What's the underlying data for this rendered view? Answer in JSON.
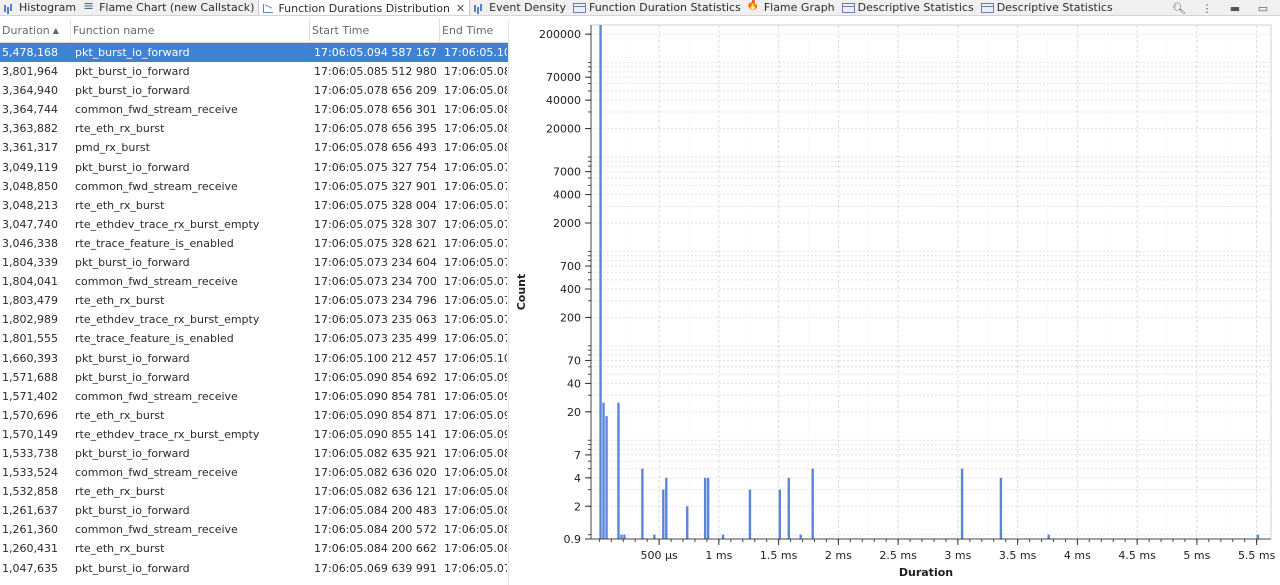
{
  "tabs": [
    {
      "label": "Histogram",
      "icon": "histogram-icon",
      "active": false
    },
    {
      "label": "Flame Chart (new Callstack)",
      "icon": "list-icon",
      "active": false
    },
    {
      "label": "Function Durations Distribution",
      "icon": "line-chart-icon",
      "active": true
    },
    {
      "label": "Event Density",
      "icon": "histogram-icon",
      "active": false
    },
    {
      "label": "Function Duration Statistics",
      "icon": "table-icon",
      "active": false
    },
    {
      "label": "Flame Graph",
      "icon": "flame-icon",
      "active": false
    },
    {
      "label": "Descriptive Statistics",
      "icon": "table-icon",
      "active": false
    },
    {
      "label": "Descriptive Statistics",
      "icon": "table-icon",
      "active": false
    }
  ],
  "toolbar": {
    "icons": [
      "zoom-icon",
      "more-icon",
      "minimize-icon",
      "maximize-icon"
    ]
  },
  "table": {
    "columns": [
      "Duration",
      "Function name",
      "Start Time",
      "End Time"
    ],
    "sort_column": "Duration",
    "rows": [
      {
        "duration": "5,478,168",
        "function": "pkt_burst_io_forward",
        "start": "17:06:05.094 587 167",
        "end": "17:06:05.10",
        "selected": true
      },
      {
        "duration": "3,801,964",
        "function": "pkt_burst_io_forward",
        "start": "17:06:05.085 512 980",
        "end": "17:06:05.08"
      },
      {
        "duration": "3,364,940",
        "function": "pkt_burst_io_forward",
        "start": "17:06:05.078 656 209",
        "end": "17:06:05.08"
      },
      {
        "duration": "3,364,744",
        "function": "common_fwd_stream_receive",
        "start": "17:06:05.078 656 301",
        "end": "17:06:05.08"
      },
      {
        "duration": "3,363,882",
        "function": "rte_eth_rx_burst",
        "start": "17:06:05.078 656 395",
        "end": "17:06:05.08"
      },
      {
        "duration": "3,361,317",
        "function": "pmd_rx_burst",
        "start": "17:06:05.078 656 493",
        "end": "17:06:05.08"
      },
      {
        "duration": "3,049,119",
        "function": "pkt_burst_io_forward",
        "start": "17:06:05.075 327 754",
        "end": "17:06:05.07"
      },
      {
        "duration": "3,048,850",
        "function": "common_fwd_stream_receive",
        "start": "17:06:05.075 327 901",
        "end": "17:06:05.07"
      },
      {
        "duration": "3,048,213",
        "function": "rte_eth_rx_burst",
        "start": "17:06:05.075 328 004",
        "end": "17:06:05.07"
      },
      {
        "duration": "3,047,740",
        "function": "rte_ethdev_trace_rx_burst_empty",
        "start": "17:06:05.075 328 307",
        "end": "17:06:05.07"
      },
      {
        "duration": "3,046,338",
        "function": "rte_trace_feature_is_enabled",
        "start": "17:06:05.075 328 621",
        "end": "17:06:05.07"
      },
      {
        "duration": "1,804,339",
        "function": "pkt_burst_io_forward",
        "start": "17:06:05.073 234 604",
        "end": "17:06:05.07"
      },
      {
        "duration": "1,804,041",
        "function": "common_fwd_stream_receive",
        "start": "17:06:05.073 234 700",
        "end": "17:06:05.07"
      },
      {
        "duration": "1,803,479",
        "function": "rte_eth_rx_burst",
        "start": "17:06:05.073 234 796",
        "end": "17:06:05.07"
      },
      {
        "duration": "1,802,989",
        "function": "rte_ethdev_trace_rx_burst_empty",
        "start": "17:06:05.073 235 063",
        "end": "17:06:05.07"
      },
      {
        "duration": "1,801,555",
        "function": "rte_trace_feature_is_enabled",
        "start": "17:06:05.073 235 499",
        "end": "17:06:05.07"
      },
      {
        "duration": "1,660,393",
        "function": "pkt_burst_io_forward",
        "start": "17:06:05.100 212 457",
        "end": "17:06:05.10"
      },
      {
        "duration": "1,571,688",
        "function": "pkt_burst_io_forward",
        "start": "17:06:05.090 854 692",
        "end": "17:06:05.09"
      },
      {
        "duration": "1,571,402",
        "function": "common_fwd_stream_receive",
        "start": "17:06:05.090 854 781",
        "end": "17:06:05.09"
      },
      {
        "duration": "1,570,696",
        "function": "rte_eth_rx_burst",
        "start": "17:06:05.090 854 871",
        "end": "17:06:05.09"
      },
      {
        "duration": "1,570,149",
        "function": "rte_ethdev_trace_rx_burst_empty",
        "start": "17:06:05.090 855 141",
        "end": "17:06:05.09"
      },
      {
        "duration": "1,533,738",
        "function": "pkt_burst_io_forward",
        "start": "17:06:05.082 635 921",
        "end": "17:06:05.08"
      },
      {
        "duration": "1,533,524",
        "function": "common_fwd_stream_receive",
        "start": "17:06:05.082 636 020",
        "end": "17:06:05.08"
      },
      {
        "duration": "1,532,858",
        "function": "rte_eth_rx_burst",
        "start": "17:06:05.082 636 121",
        "end": "17:06:05.08"
      },
      {
        "duration": "1,261,637",
        "function": "pkt_burst_io_forward",
        "start": "17:06:05.084 200 483",
        "end": "17:06:05.08"
      },
      {
        "duration": "1,261,360",
        "function": "common_fwd_stream_receive",
        "start": "17:06:05.084 200 572",
        "end": "17:06:05.08"
      },
      {
        "duration": "1,260,431",
        "function": "rte_eth_rx_burst",
        "start": "17:06:05.084 200 662",
        "end": "17:06:05.08"
      },
      {
        "duration": "1,047,635",
        "function": "pkt_burst_io_forward",
        "start": "17:06:05.069 639 991",
        "end": "17:06:05.07"
      }
    ]
  },
  "chart_data": {
    "type": "bar",
    "xlabel": "Duration",
    "ylabel": "Count",
    "y_scale": "log",
    "bar_color": "#5b86d8",
    "y_ticks": [
      0.9,
      2,
      4,
      7,
      20,
      40,
      70,
      200,
      400,
      700,
      2000,
      4000,
      7000,
      20000,
      40000,
      70000,
      200000
    ],
    "y_tick_labels": [
      "0.9",
      "2",
      "4",
      "7",
      "20",
      "40",
      "70",
      "200",
      "400",
      "700",
      "2000",
      "4000",
      "7000",
      "20000",
      "40000",
      "70000",
      "200000"
    ],
    "x_unit": "ms",
    "x_range": [
      0,
      5.5
    ],
    "x_ticks": [
      0.5,
      1,
      1.5,
      2,
      2.5,
      3,
      3.5,
      4,
      4.5,
      5,
      5.5
    ],
    "x_tick_labels": [
      "500 µs",
      "1 ms",
      "1.5 ms",
      "2 ms",
      "2.5 ms",
      "3 ms",
      "3.5 ms",
      "4 ms",
      "4.5 ms",
      "5 ms",
      "5.5 ms"
    ],
    "bar_width_ms": 0.025,
    "bars": [
      {
        "x": 0.0,
        "count": 250000
      },
      {
        "x": 0.025,
        "count": 25
      },
      {
        "x": 0.05,
        "count": 18
      },
      {
        "x": 0.15,
        "count": 25
      },
      {
        "x": 0.175,
        "count": 1
      },
      {
        "x": 0.2,
        "count": 1
      },
      {
        "x": 0.35,
        "count": 5
      },
      {
        "x": 0.45,
        "count": 1
      },
      {
        "x": 0.525,
        "count": 3
      },
      {
        "x": 0.55,
        "count": 4
      },
      {
        "x": 0.725,
        "count": 2
      },
      {
        "x": 0.875,
        "count": 4
      },
      {
        "x": 0.9,
        "count": 4
      },
      {
        "x": 1.025,
        "count": 1
      },
      {
        "x": 1.25,
        "count": 3
      },
      {
        "x": 1.5,
        "count": 3
      },
      {
        "x": 1.575,
        "count": 4
      },
      {
        "x": 1.675,
        "count": 1
      },
      {
        "x": 1.775,
        "count": 5
      },
      {
        "x": 3.025,
        "count": 5
      },
      {
        "x": 3.35,
        "count": 4
      },
      {
        "x": 3.75,
        "count": 1
      },
      {
        "x": 5.5,
        "count": 1
      }
    ]
  }
}
